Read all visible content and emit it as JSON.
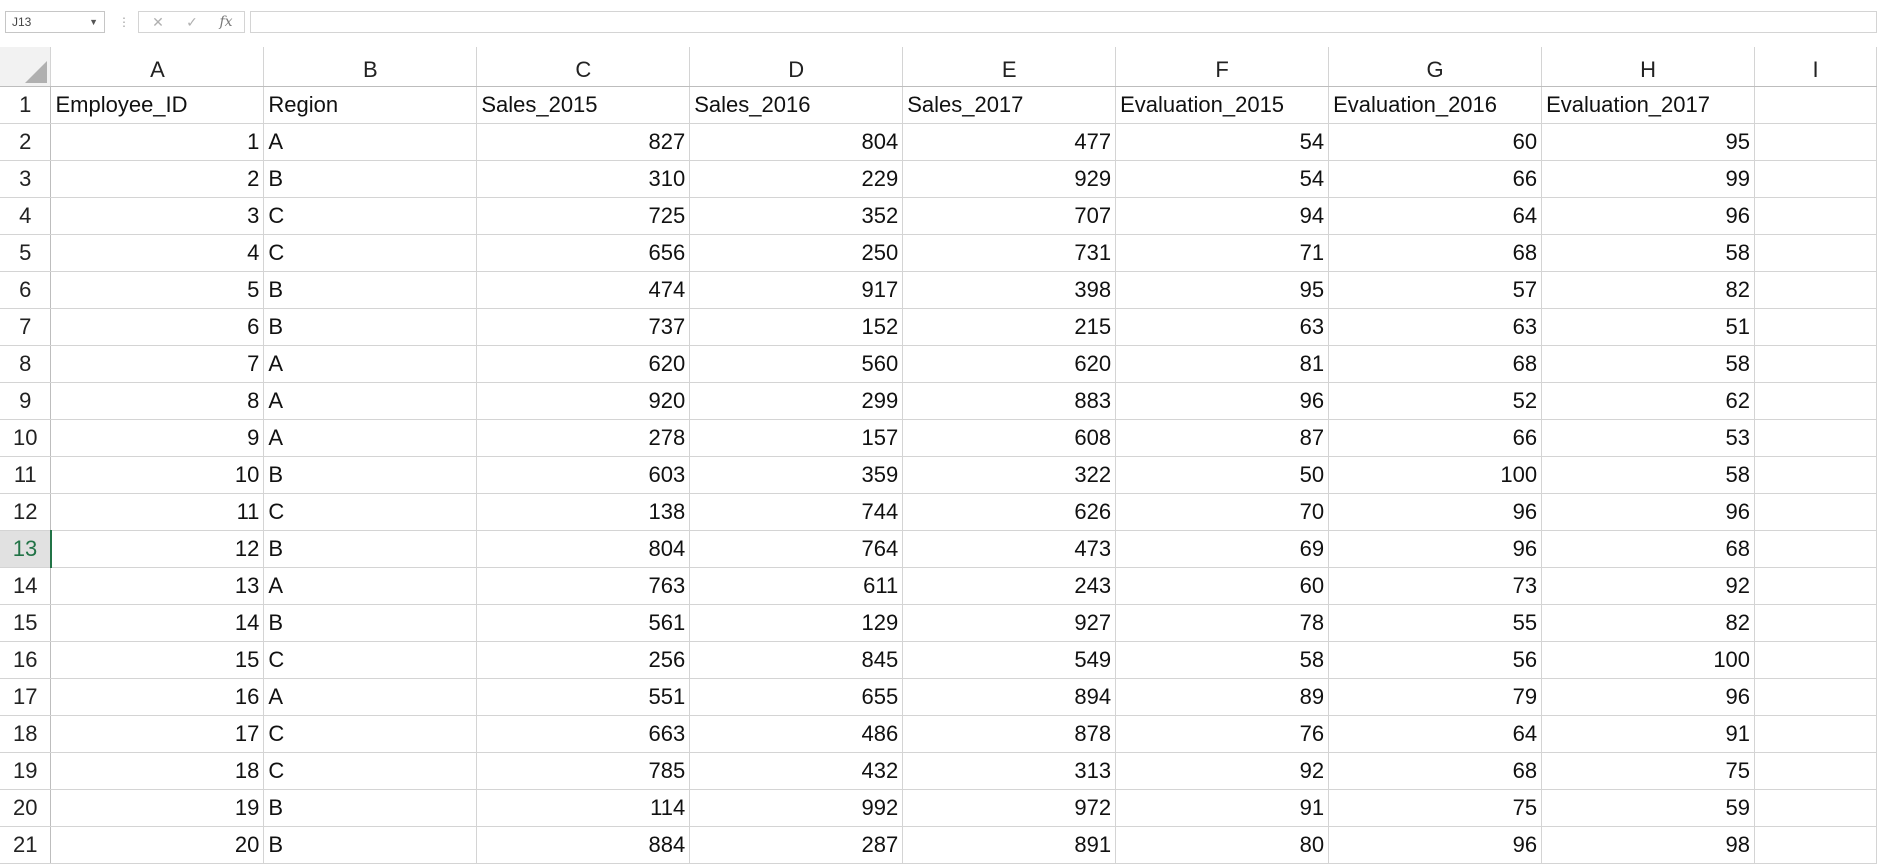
{
  "formula_bar": {
    "name_box": "J13",
    "cancel_icon": "✕",
    "enter_icon": "✓",
    "function_icon": "fx",
    "formula": ""
  },
  "sheet": {
    "columns": [
      "A",
      "B",
      "C",
      "D",
      "E",
      "F",
      "G",
      "H",
      "I"
    ],
    "active_row": 13,
    "rows": [
      {
        "n": "1",
        "cells": [
          "Employee_ID",
          "Region",
          "Sales_2015",
          "Sales_2016",
          "Sales_2017",
          "Evaluation_2015",
          "Evaluation_2016",
          "Evaluation_2017",
          ""
        ]
      },
      {
        "n": "2",
        "cells": [
          "1",
          "A",
          "827",
          "804",
          "477",
          "54",
          "60",
          "95",
          ""
        ]
      },
      {
        "n": "3",
        "cells": [
          "2",
          "B",
          "310",
          "229",
          "929",
          "54",
          "66",
          "99",
          ""
        ]
      },
      {
        "n": "4",
        "cells": [
          "3",
          "C",
          "725",
          "352",
          "707",
          "94",
          "64",
          "96",
          ""
        ]
      },
      {
        "n": "5",
        "cells": [
          "4",
          "C",
          "656",
          "250",
          "731",
          "71",
          "68",
          "58",
          ""
        ]
      },
      {
        "n": "6",
        "cells": [
          "5",
          "B",
          "474",
          "917",
          "398",
          "95",
          "57",
          "82",
          ""
        ]
      },
      {
        "n": "7",
        "cells": [
          "6",
          "B",
          "737",
          "152",
          "215",
          "63",
          "63",
          "51",
          ""
        ]
      },
      {
        "n": "8",
        "cells": [
          "7",
          "A",
          "620",
          "560",
          "620",
          "81",
          "68",
          "58",
          ""
        ]
      },
      {
        "n": "9",
        "cells": [
          "8",
          "A",
          "920",
          "299",
          "883",
          "96",
          "52",
          "62",
          ""
        ]
      },
      {
        "n": "10",
        "cells": [
          "9",
          "A",
          "278",
          "157",
          "608",
          "87",
          "66",
          "53",
          ""
        ]
      },
      {
        "n": "11",
        "cells": [
          "10",
          "B",
          "603",
          "359",
          "322",
          "50",
          "100",
          "58",
          ""
        ]
      },
      {
        "n": "12",
        "cells": [
          "11",
          "C",
          "138",
          "744",
          "626",
          "70",
          "96",
          "96",
          ""
        ]
      },
      {
        "n": "13",
        "cells": [
          "12",
          "B",
          "804",
          "764",
          "473",
          "69",
          "96",
          "68",
          ""
        ]
      },
      {
        "n": "14",
        "cells": [
          "13",
          "A",
          "763",
          "611",
          "243",
          "60",
          "73",
          "92",
          ""
        ]
      },
      {
        "n": "15",
        "cells": [
          "14",
          "B",
          "561",
          "129",
          "927",
          "78",
          "55",
          "82",
          ""
        ]
      },
      {
        "n": "16",
        "cells": [
          "15",
          "C",
          "256",
          "845",
          "549",
          "58",
          "56",
          "100",
          ""
        ]
      },
      {
        "n": "17",
        "cells": [
          "16",
          "A",
          "551",
          "655",
          "894",
          "89",
          "79",
          "96",
          ""
        ]
      },
      {
        "n": "18",
        "cells": [
          "17",
          "C",
          "663",
          "486",
          "878",
          "76",
          "64",
          "91",
          ""
        ]
      },
      {
        "n": "19",
        "cells": [
          "18",
          "C",
          "785",
          "432",
          "313",
          "92",
          "68",
          "75",
          ""
        ]
      },
      {
        "n": "20",
        "cells": [
          "19",
          "B",
          "114",
          "992",
          "972",
          "91",
          "75",
          "59",
          ""
        ]
      },
      {
        "n": "21",
        "cells": [
          "20",
          "B",
          "884",
          "287",
          "891",
          "80",
          "96",
          "98",
          ""
        ]
      }
    ]
  },
  "colors": {
    "accent": "#217346",
    "gridline": "#d4d4d4",
    "header_bg": "#f2f2f2"
  }
}
